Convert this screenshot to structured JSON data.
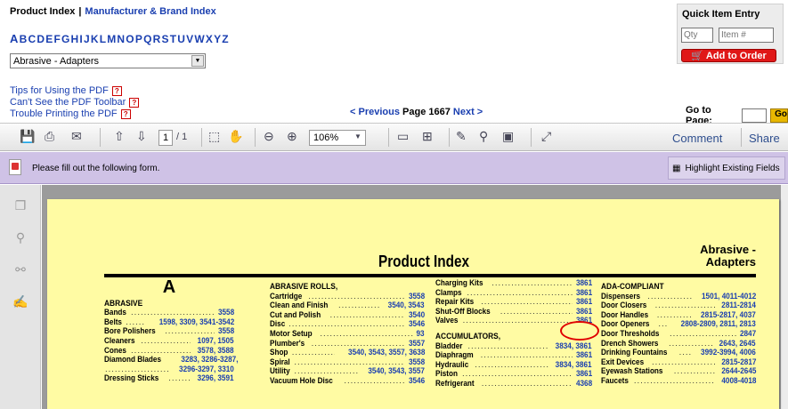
{
  "nav": {
    "product_index": "Product Index",
    "separator": "|",
    "brand_index": "Manufacturer & Brand Index"
  },
  "alphabet": [
    "A",
    "B",
    "C",
    "D",
    "E",
    "F",
    "G",
    "H",
    "I",
    "J",
    "K",
    "L",
    "M",
    "N",
    "O",
    "P",
    "Q",
    "R",
    "S",
    "T",
    "U",
    "V",
    "W",
    "X",
    "Y",
    "Z"
  ],
  "category_select": {
    "value": "Abrasive - Adapters"
  },
  "quick_entry": {
    "title": "Quick Item Entry",
    "qty_placeholder": "Qty",
    "item_placeholder": "Item #",
    "add_label": "Add to Order"
  },
  "tips": [
    "Tips for Using the PDF",
    "Can't See the PDF Toolbar",
    "Trouble Printing the PDF"
  ],
  "pager": {
    "prev": "< Previous",
    "page_label": "Page 1667",
    "next": "Next >"
  },
  "goto": {
    "label": "Go to Page:",
    "button": "Go"
  },
  "toolbar": {
    "page_num": "1",
    "page_total": "/ 1",
    "zoom": "106%",
    "comment": "Comment",
    "share": "Share"
  },
  "form_bar": {
    "message": "Please fill out the following form.",
    "highlight": "Highlight Existing Fields"
  },
  "document": {
    "title": "Product Index",
    "range_line1": "Abrasive -",
    "range_line2": "Adapters",
    "section_letter": "A",
    "col1": {
      "heading": "ABRASIVE",
      "entries": [
        {
          "name": "Bands",
          "pages": "3558"
        },
        {
          "name": "Belts",
          "pages": "1598, 3309, 3541-3542"
        },
        {
          "name": "Bore Polishers",
          "pages": "3558"
        },
        {
          "name": "Cleaners",
          "pages": "1097, 1505"
        },
        {
          "name": "Cones",
          "pages": "3578, 3588"
        },
        {
          "name": "Diamond Blades",
          "pages": "3283, 3286-3287,"
        },
        {
          "name": "",
          "pages": "3296-3297, 3310"
        },
        {
          "name": "Dressing Sticks",
          "pages": "3296, 3591"
        }
      ]
    },
    "col2": {
      "heading": "ABRASIVE ROLLS,",
      "entries": [
        {
          "name": "Cartridge",
          "pages": "3558"
        },
        {
          "name": "Clean and Finish",
          "pages": "3540, 3543"
        },
        {
          "name": "Cut and Polish",
          "pages": "3540"
        },
        {
          "name": "Disc",
          "pages": "3546"
        },
        {
          "name": "Motor Setup",
          "pages": "93"
        },
        {
          "name": "Plumber's",
          "pages": "3557"
        },
        {
          "name": "Shop",
          "pages": "3540, 3543, 3557, 3638"
        },
        {
          "name": "Spiral",
          "pages": "3558"
        },
        {
          "name": "Utility",
          "pages": "3540, 3543, 3557"
        },
        {
          "name": "Vacuum Hole Disc",
          "pages": "3546"
        }
      ]
    },
    "col3": {
      "entries_top": [
        {
          "name": "Charging Kits",
          "pages": "3861"
        },
        {
          "name": "Clamps",
          "pages": "3861"
        },
        {
          "name": "Repair Kits",
          "pages": "3861"
        },
        {
          "name": "Shut-Off Blocks",
          "pages": "3861"
        },
        {
          "name": "Valves",
          "pages": "3861"
        }
      ],
      "heading": "ACCUMULATORS,",
      "entries": [
        {
          "name": "Bladder",
          "pages": "3834, 3861"
        },
        {
          "name": "Diaphragm",
          "pages": "3861"
        },
        {
          "name": "Hydraulic",
          "pages": "3834, 3861"
        },
        {
          "name": "Piston",
          "pages": "3861"
        },
        {
          "name": "Refrigerant",
          "pages": "4368"
        }
      ]
    },
    "col4": {
      "heading": "ADA-COMPLIANT",
      "entries": [
        {
          "name": "Dispensers",
          "pages": "1501, 4011-4012"
        },
        {
          "name": "Door Closers",
          "pages": "2811-2814"
        },
        {
          "name": "Door Handles",
          "pages": "2815-2817, 4037"
        },
        {
          "name": "Door Openers",
          "pages": "2808-2809, 2811, 2813"
        },
        {
          "name": "Door Thresholds",
          "pages": "2847"
        },
        {
          "name": "Drench Showers",
          "pages": "2643, 2645"
        },
        {
          "name": "Drinking Fountains",
          "pages": "3992-3994, 4006"
        },
        {
          "name": "Exit Devices",
          "pages": "2815-2817"
        },
        {
          "name": "Eyewash Stations",
          "pages": "2644-2645"
        },
        {
          "name": "Faucets",
          "pages": "4008-4018"
        }
      ]
    }
  },
  "colors": {
    "link": "#1a3fb0",
    "form_bar": "#cfc2e6",
    "page_bg": "#fffba3",
    "highlight_circle": "#e00000",
    "add_button": "#e01818"
  }
}
